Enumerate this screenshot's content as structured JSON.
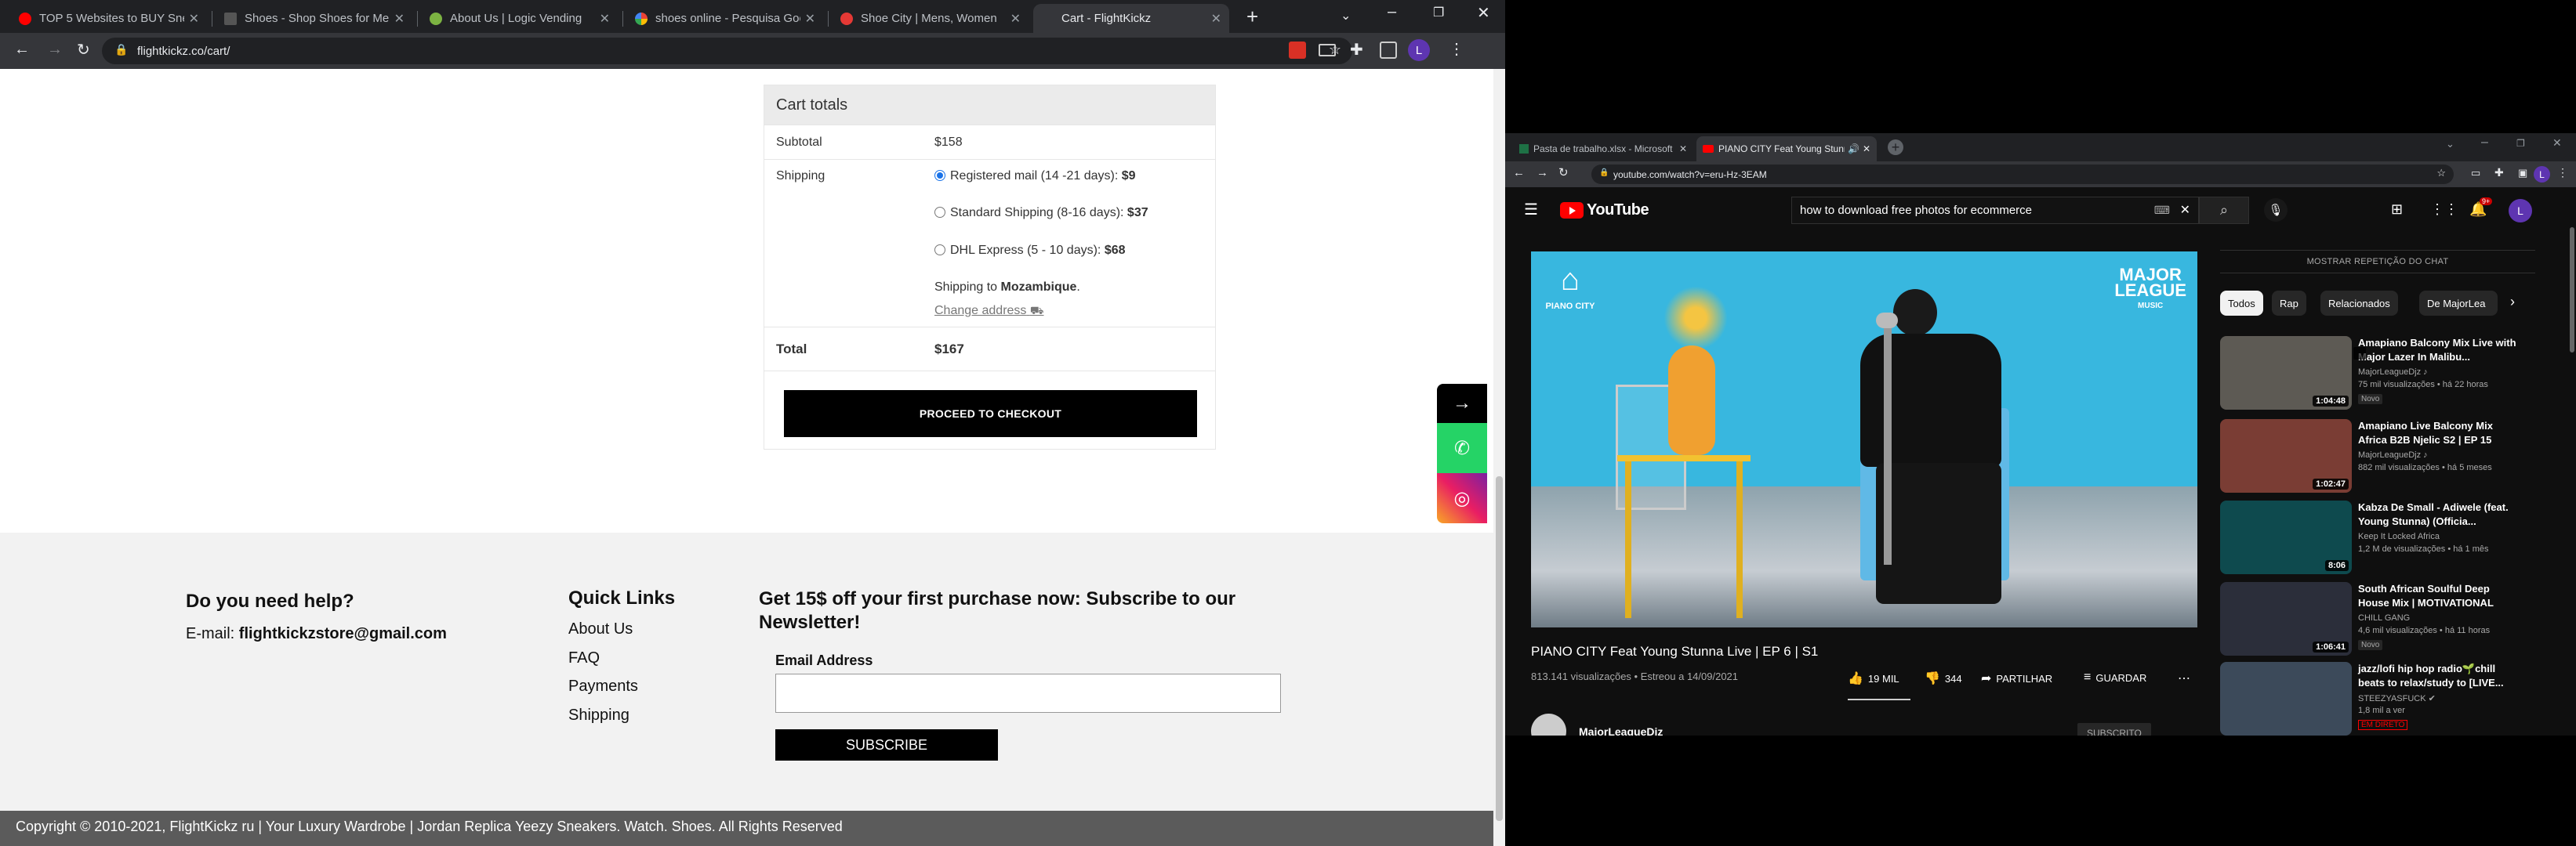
{
  "left_browser": {
    "tabs": [
      {
        "title": "TOP 5 Websites to BUY Snea",
        "fav": "#ff0000"
      },
      {
        "title": "Shoes - Shop Shoes for Men",
        "fav": "#555555"
      },
      {
        "title": "About Us | Logic Vending",
        "fav": "#7cb342"
      },
      {
        "title": "shoes online - Pesquisa Goo",
        "fav": "#4285f4"
      },
      {
        "title": "Shoe City | Mens, Women ",
        "fav": "#e53935"
      },
      {
        "title": "Cart - FlightKickz",
        "fav": "#35363a"
      }
    ],
    "new_tab": "+",
    "url": "flightkickz.co/cart/",
    "profile_initial": "L"
  },
  "cart": {
    "heading": "Cart totals",
    "subtotal_label": "Subtotal",
    "subtotal_value": "$158",
    "shipping_label": "Shipping",
    "options": [
      {
        "label": "Registered mail (14 -21 days):",
        "price": "$9",
        "selected": true
      },
      {
        "label": "Standard Shipping (8-16 days):",
        "price": "$37",
        "selected": false
      },
      {
        "label": "DHL Express (5 - 10 days):",
        "price": "$68",
        "selected": false
      }
    ],
    "shipping_to_prefix": "Shipping to ",
    "shipping_to_country": "Mozambique",
    "shipping_to_suffix": ".",
    "change_address": "Change address",
    "total_label": "Total",
    "total_value": "$167",
    "checkout_label": "PROCEED TO CHECKOUT"
  },
  "footer": {
    "help_title": "Do you need help?",
    "email_prefix": "E-mail: ",
    "email": "flightkickzstore@gmail.com",
    "quick_links_title": "Quick Links",
    "links": [
      "About Us",
      "FAQ",
      "Payments",
      "Shipping"
    ],
    "newsletter_title": "Get 15$ off your first purchase now: Subscribe to our Newsletter!",
    "email_field_label": "Email Address",
    "subscribe_label": "SUBSCRIBE",
    "copyright": "Copyright © 2010-2021, FlightKickz ru | Your Luxury Wardrobe | Jordan Replica Yeezy Sneakers. Watch. Shoes. All Rights Reserved"
  },
  "right_browser": {
    "tabs": [
      {
        "title": "Pasta de trabalho.xlsx - Microsoft"
      },
      {
        "title": "PIANO CITY Feat Young Stunn"
      }
    ],
    "url": "youtube.com/watch?v=eru-Hz-3EAM",
    "profile_initial": "L"
  },
  "youtube": {
    "logo": "YouTube",
    "search_query": "how to download free photos for ecommerce",
    "notif_count": "9+",
    "avatar_initial": "L",
    "video_brand_left": "PIANO CITY",
    "video_brand_right_1": "MAJOR",
    "video_brand_right_2": "LEAGUE",
    "video_brand_right_3": "MUSIC",
    "video_title": "PIANO CITY Feat Young Stunna Live | EP 6 | S1",
    "video_meta": "813.141 visualizações • Estreou a 14/09/2021",
    "likes": "19 MIL",
    "dislikes": "344",
    "share": "PARTILHAR",
    "save": "GUARDAR",
    "more": "⋯",
    "channel": "MajorLeagueDjz",
    "subscribe": "SUBSCRITO",
    "chat_replay": "MOSTRAR REPETIÇÃO DO CHAT",
    "chips": [
      "Todos",
      "Rap",
      "Relacionados",
      "De MajorLea"
    ],
    "recommendations": [
      {
        "title": "Amapiano Balcony Mix Live with Major Lazer In Malibu...",
        "channel": "MajorLeagueDjz ♪",
        "views": "75 mil visualizações • há 22 horas",
        "badge": "Novo",
        "duration": "1:04:48",
        "thumb": "#5d5a54"
      },
      {
        "title": "Amapiano Live Balcony Mix Africa B2B Njelic S2 | EP 15",
        "channel": "MajorLeagueDjz ♪",
        "views": "882 mil visualizações • há 5 meses",
        "badge": "",
        "duration": "1:02:47",
        "thumb": "#7a3d34"
      },
      {
        "title": "Kabza De Small - Adiwele (feat. Young Stunna) (Officia...",
        "channel": "Keep It Locked Africa",
        "views": "1,2 M de visualizações • há 1 mês",
        "badge": "",
        "duration": "8:06",
        "thumb": "#0e4a4e"
      },
      {
        "title": "South African Soulful Deep House Mix | MOTIVATIONAL",
        "channel": "CHILL GANG",
        "views": "4,6 mil visualizações • há 11 horas",
        "badge": "Novo",
        "duration": "1:06:41",
        "thumb": "#2b2e3a"
      },
      {
        "title": "jazz/lofi hip hop radio🌱chill beats to relax/study to [LIVE...",
        "channel": "STEEZYASFUCK ✔",
        "views": "1,8 mil a ver",
        "badge": "EM DIRETO",
        "duration": "",
        "thumb": "#3c4a5a"
      }
    ]
  }
}
